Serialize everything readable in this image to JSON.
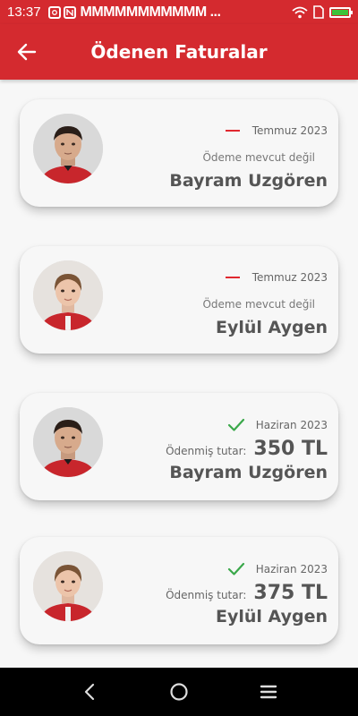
{
  "status_bar": {
    "time": "13:37",
    "notifications": "MMMMMMMMMMM ..."
  },
  "app_bar": {
    "title": "Ödenen Faturalar"
  },
  "cards": [
    {
      "period": "Temmuz 2023",
      "paid": false,
      "status_text": "Ödeme mevcut değil",
      "name": "Bayram Uzgören",
      "photo": "boy"
    },
    {
      "period": "Temmuz 2023",
      "paid": false,
      "status_text": "Ödeme mevcut değil",
      "name": "Eylül Aygen",
      "photo": "girl"
    },
    {
      "period": "Haziran 2023",
      "paid": true,
      "amount_label": "Ödenmiş tutar:",
      "amount": "350 TL",
      "name": "Bayram Uzgören",
      "photo": "boy"
    },
    {
      "period": "Haziran 2023",
      "paid": true,
      "amount_label": "Ödenmiş tutar:",
      "amount": "375 TL",
      "name": "Eylül Aygen",
      "photo": "girl"
    }
  ],
  "colors": {
    "primary": "#d42a2f",
    "unpaid_dash": "#e0282f",
    "paid_check": "#3aa84a"
  },
  "icons": {
    "back": "arrow-left-icon",
    "unpaid": "dash-icon",
    "paid": "check-icon",
    "nav_back": "chevron-left-icon",
    "nav_home": "circle-icon",
    "nav_menu": "menu-icon"
  }
}
